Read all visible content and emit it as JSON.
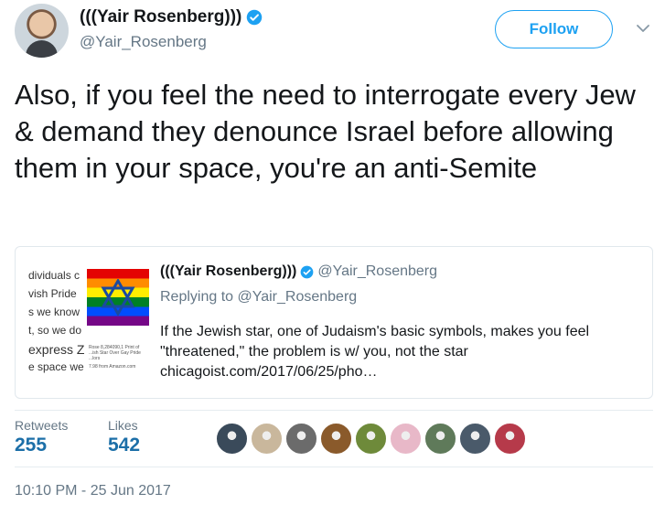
{
  "author": {
    "display_name": "(((Yair Rosenberg)))",
    "handle": "@Yair_Rosenberg",
    "avatar_icon": "profile-photo",
    "verified_icon": "verified-badge-icon"
  },
  "actions": {
    "follow_label": "Follow",
    "menu_icon": "chevron-down-icon"
  },
  "tweet": {
    "text": "Also, if you feel the need to interrogate every Jew & demand they denounce Israel before allowing them in your space, you're an anti-Semite"
  },
  "quoted_tweet": {
    "display_name": "(((Yair Rosenberg)))",
    "handle": "@Yair_Rosenberg",
    "replying_prefix": "Replying to",
    "replying_to": "@Yair_Rosenberg",
    "text": "If the Jewish star, one of Judaism's basic symbols, makes you feel \"threatened,\" the problem is w/ you, not the star",
    "link": "chicagoist.com/2017/06/25/pho…",
    "thumbnail": {
      "lines": [
        "dividuals c",
        "vish Pride",
        "s we know",
        "t, so we do",
        "express Z",
        "e space we"
      ],
      "caption": "Rose 8,284090,1 Print of ...ish Star Over Gay Pride ...lors",
      "price": "7.98 from Amazon.com"
    }
  },
  "stats": {
    "retweets_label": "Retweets",
    "retweets_count": "255",
    "likes_label": "Likes",
    "likes_count": "542"
  },
  "likers": {
    "avatars": [
      "#3a4a5a",
      "#c9b79c",
      "#6b6b6b",
      "#8a5a2b",
      "#6e8a3a",
      "#e8b8c8",
      "#5f7a5a",
      "#4a5a6a",
      "#b63a4a"
    ]
  },
  "timestamp": "10:10 PM - 25 Jun 2017",
  "colors": {
    "accent": "#1da1f2",
    "count": "#1c6fa8",
    "secondary_text": "#657786"
  }
}
